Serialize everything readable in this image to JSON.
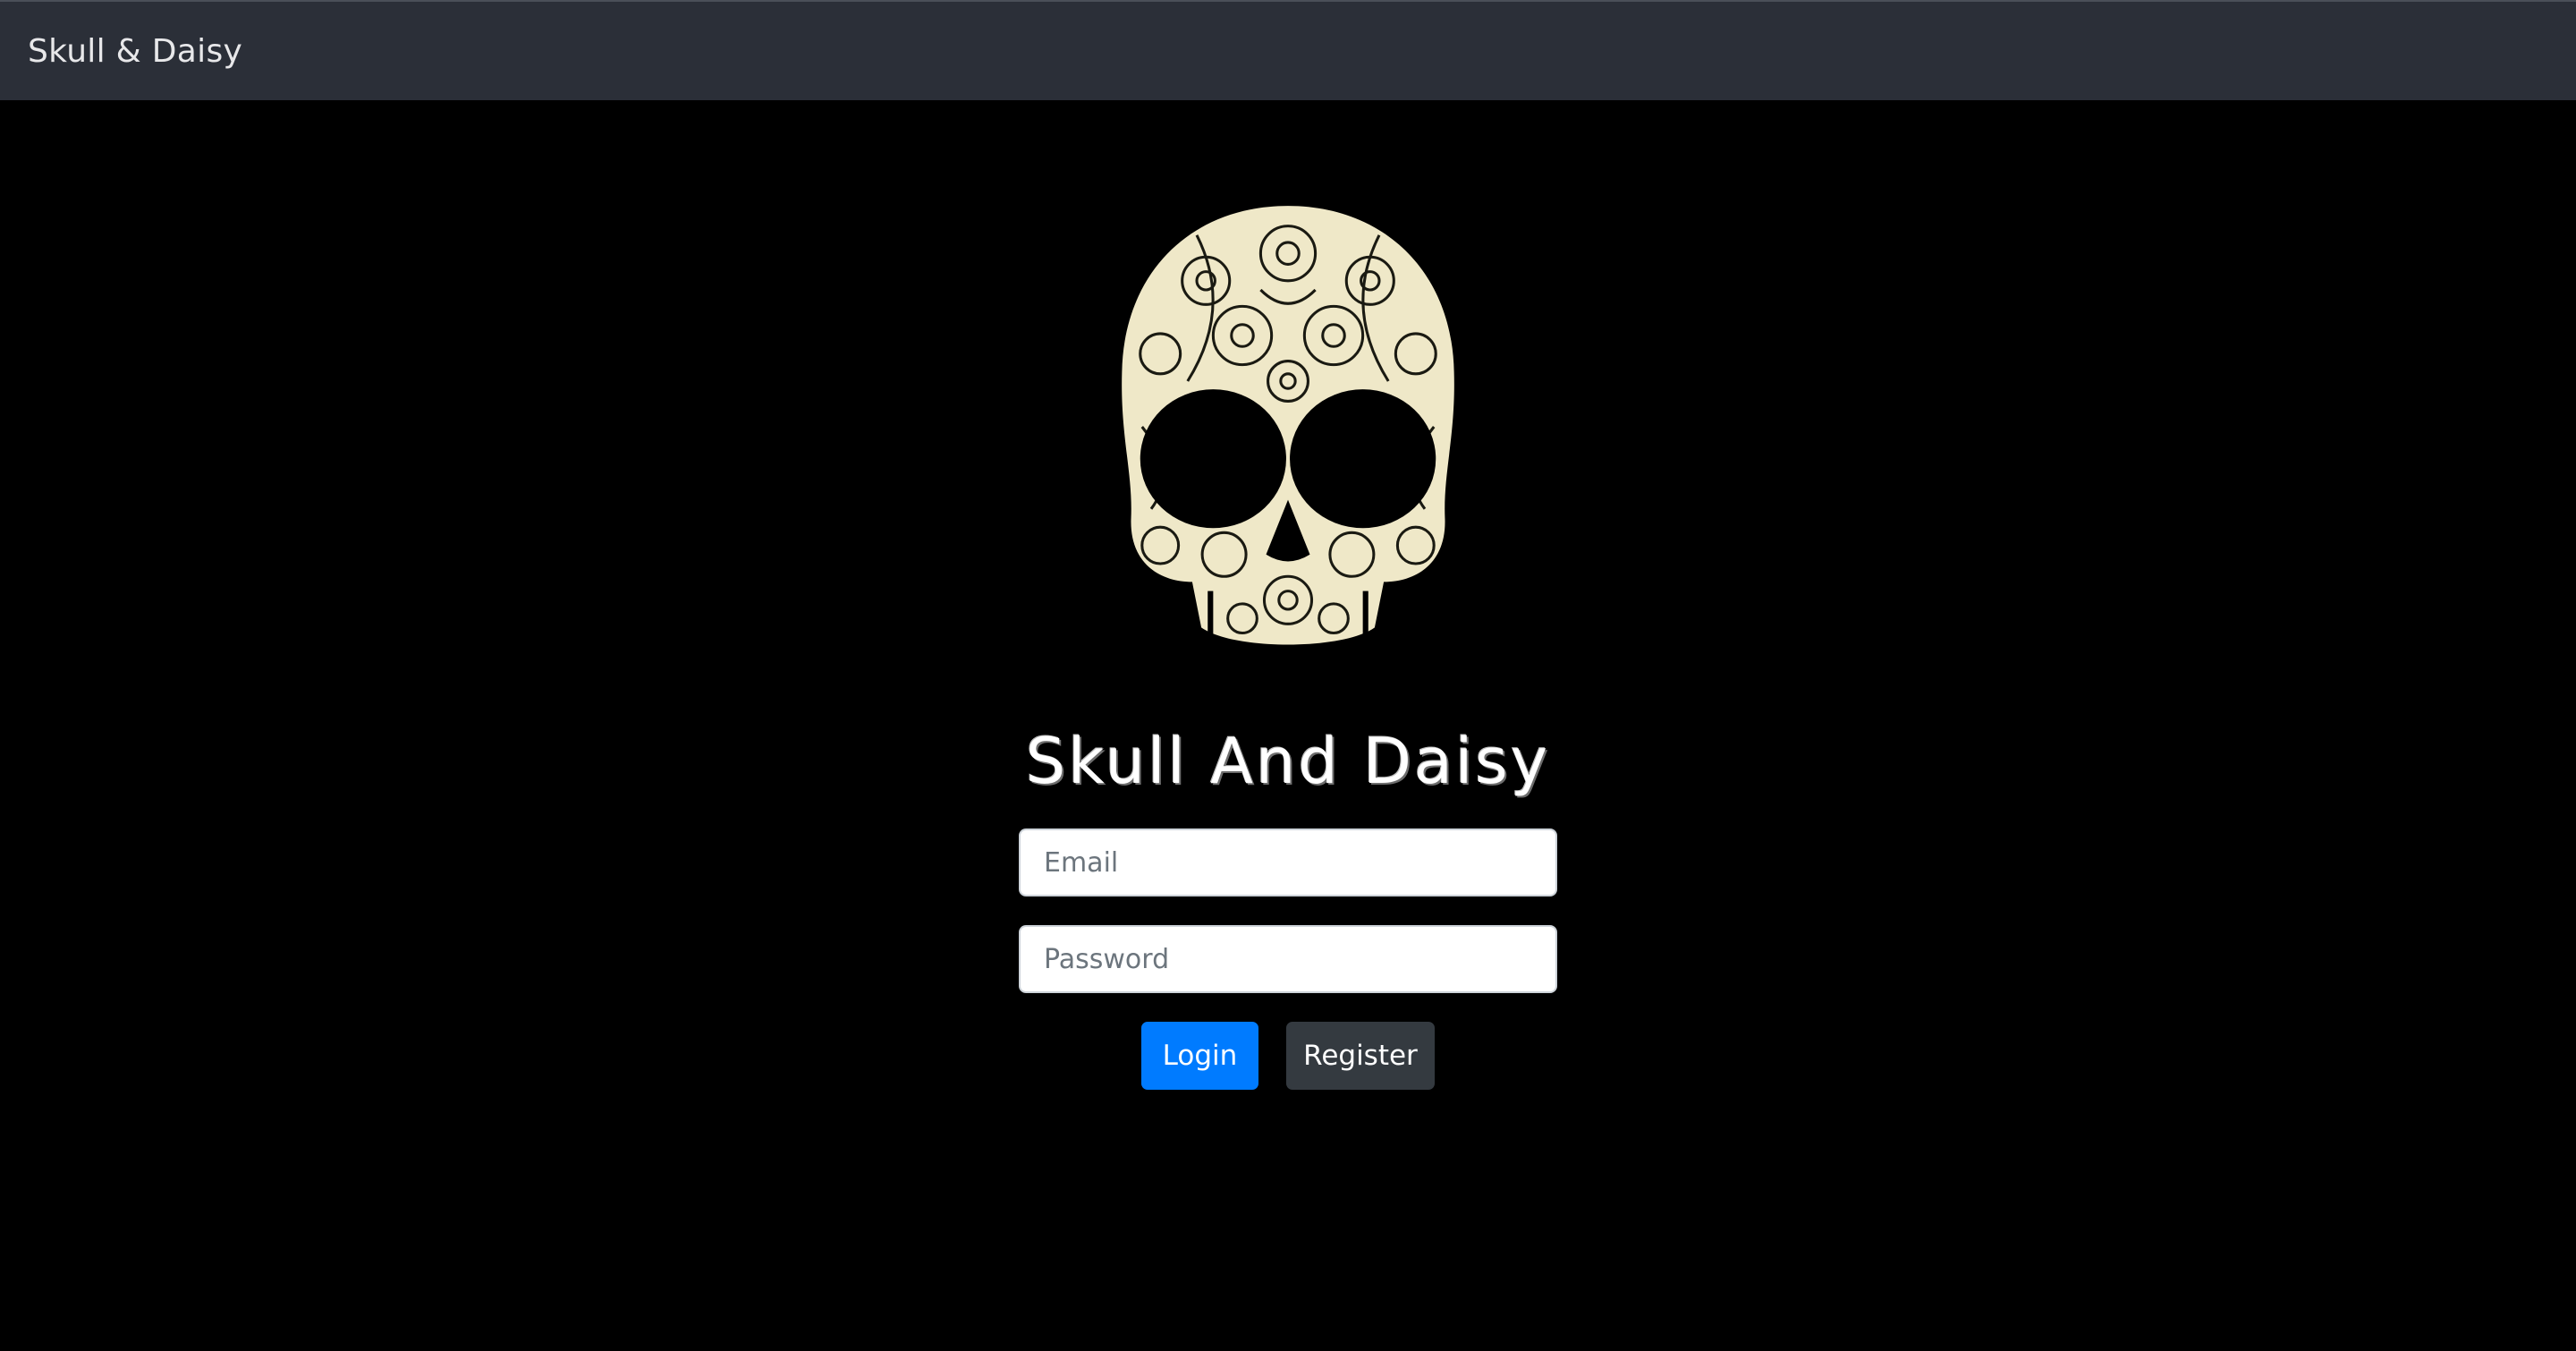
{
  "navbar": {
    "brand": "Skull & Daisy"
  },
  "logo": {
    "icon": "floral-skull-icon",
    "color": "#efe8c8"
  },
  "main": {
    "title": "Skull And Daisy"
  },
  "form": {
    "email_placeholder": "Email",
    "password_placeholder": "Password",
    "login_label": "Login",
    "register_label": "Register"
  },
  "colors": {
    "navbar_bg": "#2b2f38",
    "page_bg": "#000000",
    "login_button": "#007bff",
    "register_button": "#343a40"
  }
}
